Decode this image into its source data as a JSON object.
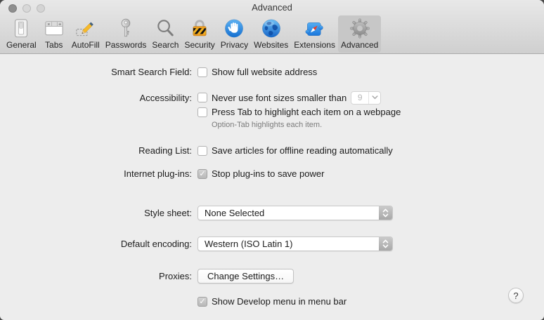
{
  "titlebar": {
    "title": "Advanced"
  },
  "toolbar": {
    "selected": "Advanced",
    "items": [
      {
        "label": "General",
        "icon": "light-switch-icon"
      },
      {
        "label": "Tabs",
        "icon": "tabs-window-icon"
      },
      {
        "label": "AutoFill",
        "icon": "pencil-icon"
      },
      {
        "label": "Passwords",
        "icon": "key-icon"
      },
      {
        "label": "Search",
        "icon": "magnifier-icon"
      },
      {
        "label": "Security",
        "icon": "padlock-icon"
      },
      {
        "label": "Privacy",
        "icon": "stop-hand-icon"
      },
      {
        "label": "Websites",
        "icon": "globe-icon"
      },
      {
        "label": "Extensions",
        "icon": "puzzle-icon"
      },
      {
        "label": "Advanced",
        "icon": "gear-icon"
      }
    ]
  },
  "content": {
    "smart_search": {
      "label": "Smart Search Field:",
      "option": "Show full website address",
      "checked": false
    },
    "accessibility": {
      "label": "Accessibility:",
      "font_size_option": "Never use font sizes smaller than",
      "font_size_value": "9",
      "font_size_checked": false,
      "tab_highlight_option": "Press Tab to highlight each item on a webpage",
      "tab_highlight_checked": false,
      "note": "Option-Tab highlights each item."
    },
    "reading_list": {
      "label": "Reading List:",
      "option": "Save articles for offline reading automatically",
      "checked": false
    },
    "internet_plugins": {
      "label": "Internet plug-ins:",
      "option": "Stop plug-ins to save power",
      "checked": true
    },
    "style_sheet": {
      "label": "Style sheet:",
      "value": "None Selected"
    },
    "default_encoding": {
      "label": "Default encoding:",
      "value": "Western (ISO Latin 1)"
    },
    "proxies": {
      "label": "Proxies:",
      "button_label": "Change Settings…"
    },
    "develop_menu": {
      "option": "Show Develop menu in menu bar",
      "checked": true
    },
    "help_button": "?"
  },
  "colors": {
    "toolbar_gradient_top": "#e8e8e8",
    "toolbar_gradient_bottom": "#cfcfcf",
    "content_bg": "#ededed",
    "selected_tab_bg": "#c7c7c7",
    "disabled_text": "#b8b8b8",
    "security_gold": "#ef9d1e",
    "privacy_blue": "#1b7fdb",
    "extensions_blue": "#2f8de8"
  }
}
